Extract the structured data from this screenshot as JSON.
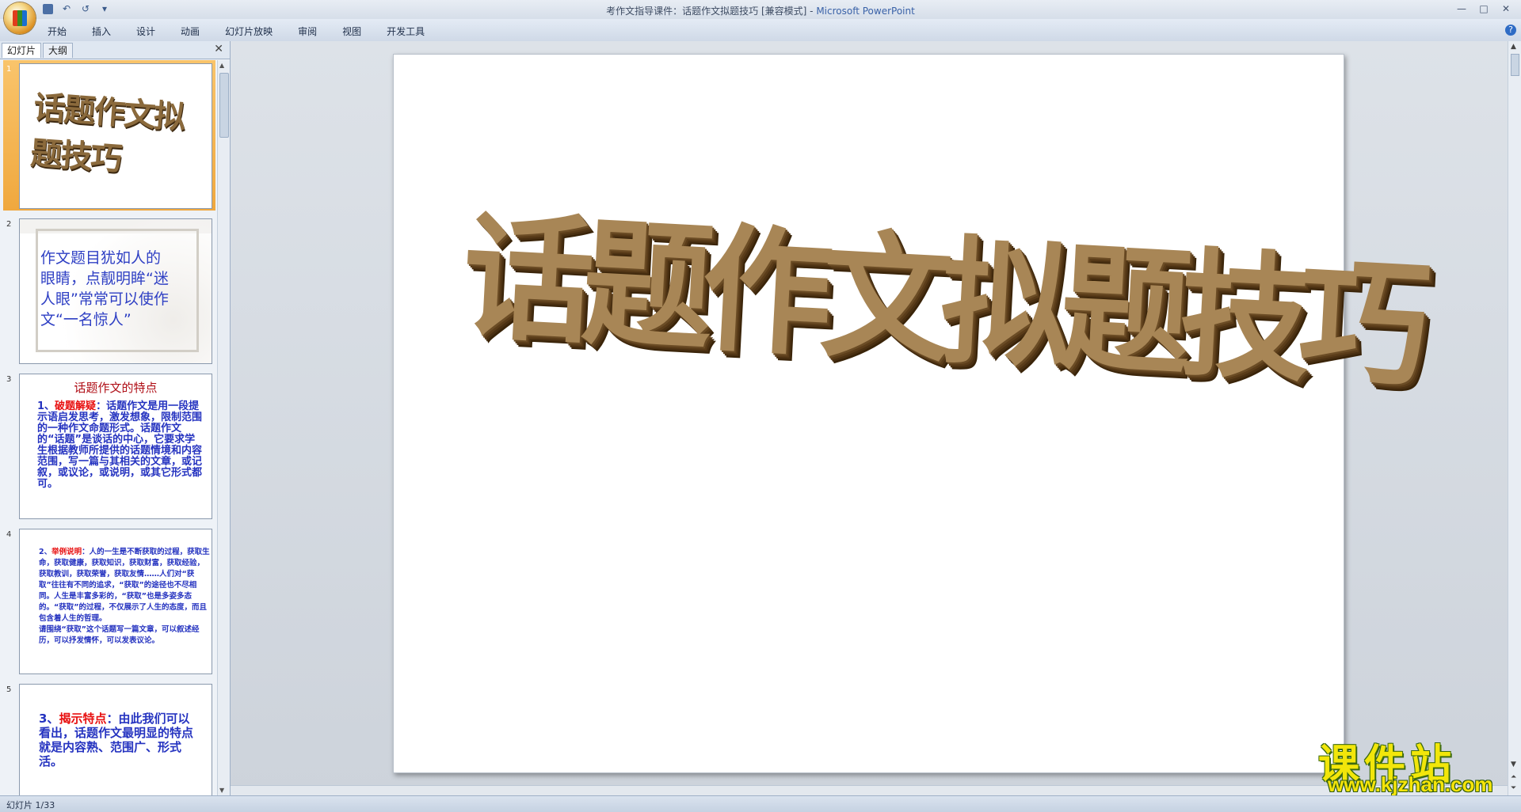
{
  "window": {
    "title_doc": "考作文指导课件：话题作文拟题技巧 [兼容模式]",
    "title_sep": " - ",
    "title_app": "Microsoft PowerPoint",
    "minimize": "—",
    "maximize": "□",
    "close": "✕"
  },
  "qat": {
    "undo": "↶",
    "redo": "↺",
    "more": "▾"
  },
  "ribbon": {
    "tabs": [
      "开始",
      "插入",
      "设计",
      "动画",
      "幻灯片放映",
      "审阅",
      "视图",
      "开发工具"
    ],
    "help": "?"
  },
  "panel": {
    "tab_slides": "幻灯片",
    "tab_outline": "大纲",
    "close": "✕"
  },
  "thumbnails": [
    {
      "number": "1",
      "title": "话题作文拟题技巧"
    },
    {
      "number": "2",
      "text": "作文题目犹如人的眼睛，点靓明眸“迷人眼”常常可以使作文“一名惊人”"
    },
    {
      "number": "3",
      "title": "话题作文的特点",
      "lead": "1、",
      "key": "破题解疑",
      "body": "：话题作文是用一段提示语启发思考，激发想象，限制范围的一种作文命题形式。话题作文的“话题”是谈话的中心，它要求学生根据教师所提供的话题情境和内容范围，写一篇与其相关的文章，或记叙，或议论，或说明，或其它形式都可。"
    },
    {
      "number": "4",
      "lead": "2、",
      "key": "举例说明",
      "body": "：人的一生是不断获取的过程，获取生命，获取健康，获取知识，获取财富，获取经验，获取教训，获取荣誉，获取友情……人们对“获取”往往有不同的追求，“获取”的途径也不尽相同。人生是丰富多彩的，“获取”也是多姿多态的。“获取”的过程，不仅展示了人生的态度，而且包含着人生的哲理。",
      "body2": "请围绕“获取”这个话题写一篇文章，可以叙述经历，可以抒发情怀，可以发表议论。"
    },
    {
      "number": "5",
      "lead": "3、",
      "key": "揭示特点",
      "body": "：由此我们可以看出，话题作文最明显的特点就是内容熟、范围广、形式活。"
    }
  ],
  "slide": {
    "title": "话题作文拟题技巧"
  },
  "watermark": {
    "cn": "课件站",
    "url": "www.kjzhan.com"
  },
  "status": {
    "slide_indicator": "幻灯片 1/33"
  }
}
